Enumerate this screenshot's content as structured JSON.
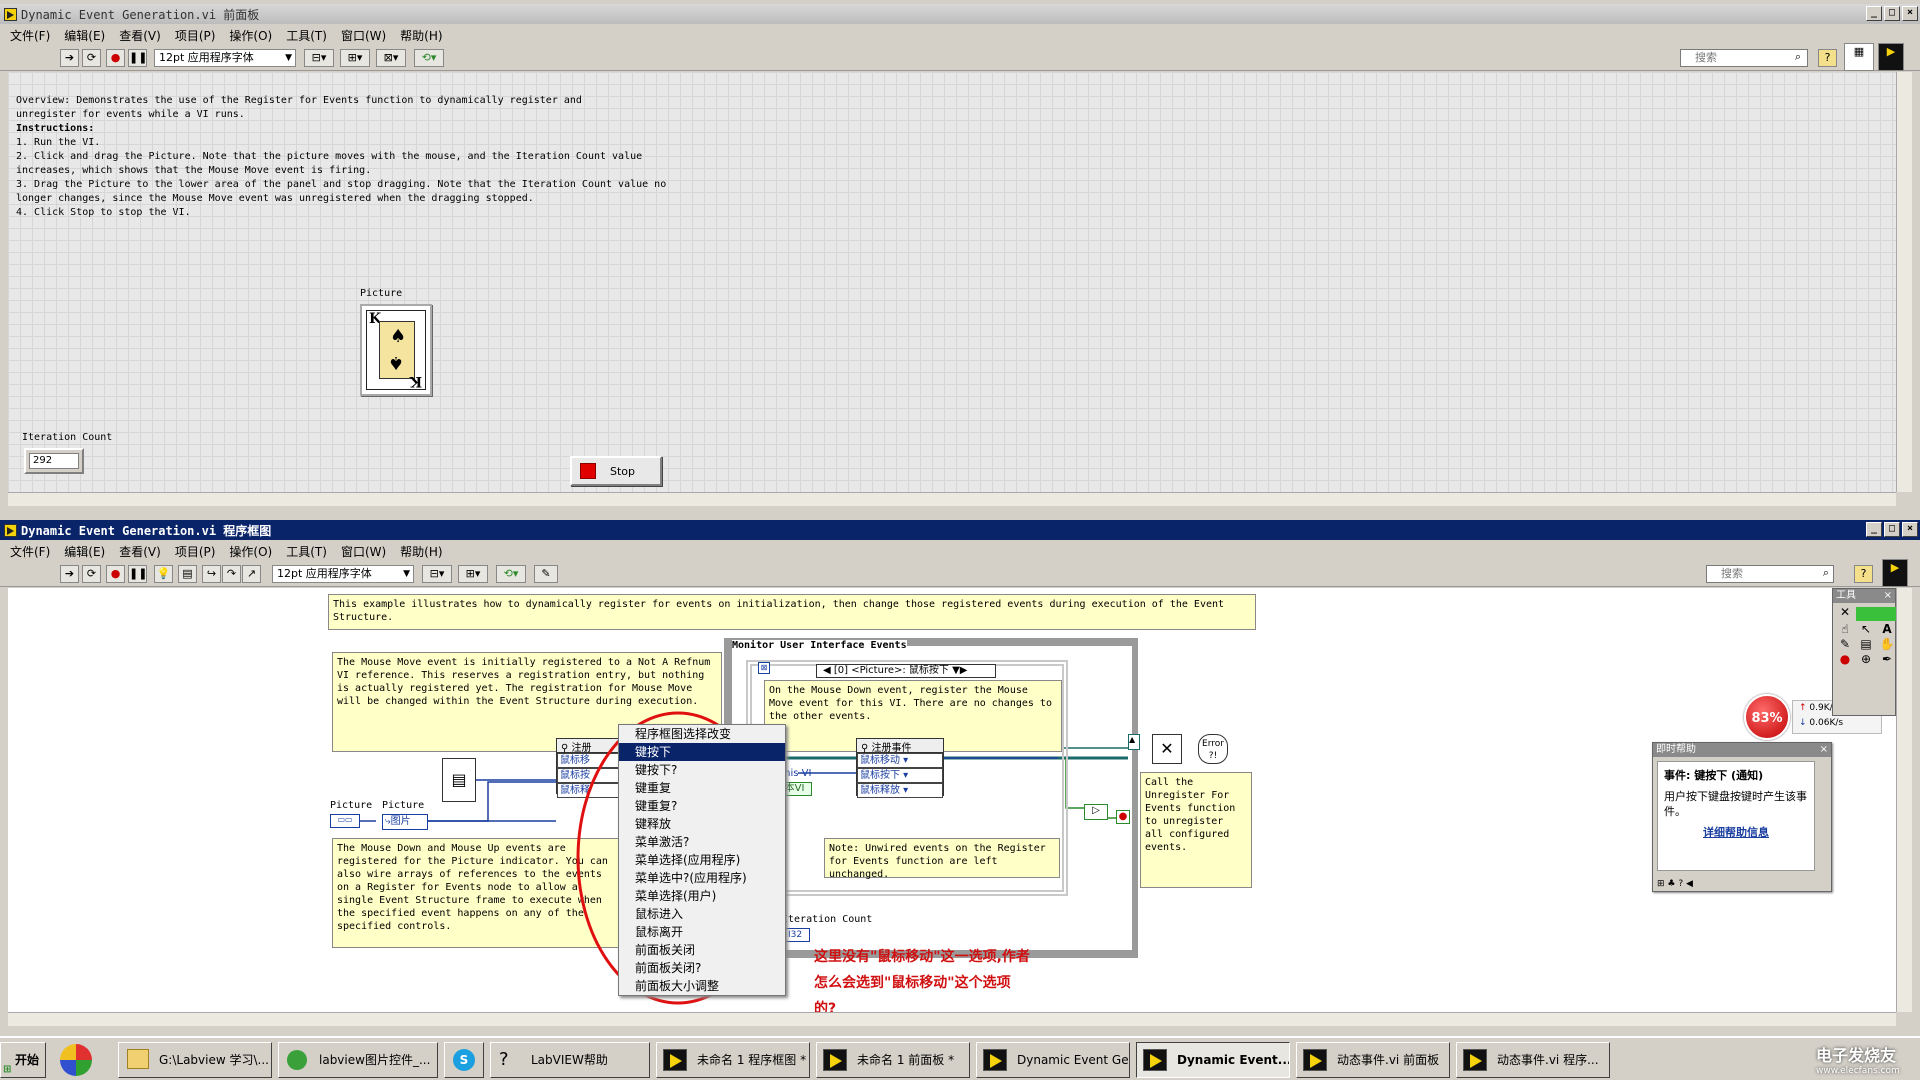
{
  "front_window": {
    "title": "Dynamic Event Generation.vi 前面板",
    "menu": [
      "文件(F)",
      "编辑(E)",
      "查看(V)",
      "项目(P)",
      "操作(O)",
      "工具(T)",
      "窗口(W)",
      "帮助(H)"
    ],
    "font_selector": "12pt 应用程序字体",
    "search_placeholder": "搜索",
    "overview_lines": [
      "Overview: Demonstrates the use of the Register for Events function to dynamically register and",
      "unregister for events while a VI runs.",
      "Instructions:",
      "1. Run the VI.",
      "2. Click and drag the Picture. Note that the picture moves with the mouse, and the Iteration Count value",
      "increases, which shows that the Mouse Move event is firing.",
      "3. Drag the Picture to the lower area of the panel and stop dragging. Note that the Iteration Count value no",
      "longer changes, since the Mouse Move event was unregistered when the dragging stopped.",
      "4. Click Stop to stop the VI."
    ],
    "picture_label": "Picture",
    "card_rank": "K",
    "iteration_label": "Iteration Count",
    "iteration_value": "292",
    "stop_label": "Stop"
  },
  "block_window": {
    "title": "Dynamic Event Generation.vi 程序框图",
    "menu": [
      "文件(F)",
      "编辑(E)",
      "查看(V)",
      "项目(P)",
      "操作(O)",
      "工具(T)",
      "窗口(W)",
      "帮助(H)"
    ],
    "font_selector": "12pt 应用程序字体",
    "search_placeholder": "搜索",
    "top_note": "This example illustrates how to dynamically register for events on initialization, then change those registered events during execution of the Event Structure.",
    "note_mouse_move": "The Mouse Move event is initially registered to a Not A Refnum VI reference. This reserves a registration entry, but nothing is actually registered yet. The registration for Mouse Move will be changed within the Event Structure during execution.",
    "note_mouse_down": "The Mouse Down and Mouse Up events are registered for the Picture indicator. You can also wire arrays of references to the events on a Register for Events node to allow a single Event Structure frame to execute when the specified event happens on any of the specified controls.",
    "loop_label": "Monitor User Interface Events",
    "event_selector": "[0] <Picture>: 鼠标按下",
    "note_on_mouse_down": "On the Mouse Down event, register the Mouse Move event for this VI. There are no changes to the other events.",
    "note_unwired": "Note: Unwired events on the Register for Events function are left unchanged.",
    "note_unregister": "Call the Unregister For Events function to unregister all configured events.",
    "picture_term_1": "Picture",
    "picture_term_2": "Picture",
    "picture_ref": "图片",
    "register_node_left": {
      "title": "注册",
      "rows": [
        "鼠标移",
        "鼠标按",
        "鼠标释"
      ]
    },
    "register_node_right": {
      "title": "注册事件",
      "rows": [
        "鼠标移动",
        "鼠标按下",
        "鼠标释放"
      ]
    },
    "this_vi": "This VI",
    "this_vi_short": "本VI",
    "iteration_label": "Iteration Count",
    "i32": "I32",
    "error_label": "Error",
    "context_menu": [
      "程序框图选择改变",
      "键按下",
      "键按下?",
      "键重复",
      "键重复?",
      "键释放",
      "菜单激活?",
      "菜单选择(应用程序)",
      "菜单选中?(应用程序)",
      "菜单选择(用户)",
      "鼠标进入",
      "鼠标离开",
      "前面板关闭",
      "前面板关闭?",
      "前面板大小调整"
    ],
    "context_selected": 1,
    "annotation": [
      "这里没有\"鼠标移动\"这一选项,作者",
      "怎么会选到\"鼠标移动\"这个选项",
      "的?"
    ],
    "tools_title": "工具",
    "help_panel": {
      "title": "即时帮助",
      "heading": "事件: 键按下 (通知)",
      "body": "用户按下键盘按键时产生该事件。",
      "link": "详细帮助信息"
    },
    "net_meter": {
      "percent": "83%",
      "up": "0.9K/s",
      "down": "0.06K/s"
    }
  },
  "taskbar": {
    "start": "开始",
    "items": [
      "G:\\Labview 学习\\...",
      "labview图片控件_...",
      "",
      "LabVIEW帮助",
      "未命名 1 程序框图 *",
      "未命名 1 前面板 *",
      "Dynamic Event Ge...",
      "Dynamic Event...",
      "动态事件.vi 前面板",
      "动态事件.vi 程序..."
    ],
    "active_index": 7,
    "watermark": "电子发烧友",
    "watermark_url": "www.elecfans.com"
  },
  "colors": {
    "titlebar_active": "#0a246a",
    "note_bg": "#ffffc8",
    "annotation": "#d01010",
    "ellipse": "#e01010",
    "stop_red": "#e00000"
  }
}
